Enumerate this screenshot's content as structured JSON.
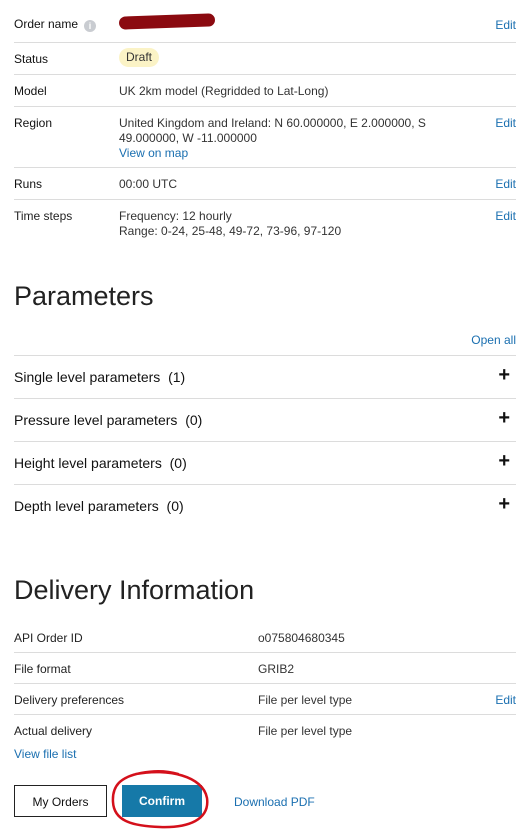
{
  "order": {
    "name_label": "Order name",
    "edit_label": "Edit",
    "status_label": "Status",
    "status_value": "Draft",
    "model_label": "Model",
    "model_value": "UK 2km model (Regridded to Lat-Long)",
    "region_label": "Region",
    "region_value_line1": "United Kingdom and Ireland: N 60.000000, E 2.000000, S",
    "region_value_line2": "49.000000, W -11.000000",
    "region_map_link": "View on map",
    "runs_label": "Runs",
    "runs_value": "00:00 UTC",
    "timesteps_label": "Time steps",
    "timesteps_frequency": "Frequency: 12 hourly",
    "timesteps_range": "Range: 0-24, 25-48, 49-72, 73-96, 97-120"
  },
  "parameters": {
    "heading": "Parameters",
    "open_all": "Open all",
    "groups": [
      {
        "label": "Single level parameters",
        "count": "(1)"
      },
      {
        "label": "Pressure level parameters",
        "count": "(0)"
      },
      {
        "label": "Height level parameters",
        "count": "(0)"
      },
      {
        "label": "Depth level parameters",
        "count": "(0)"
      }
    ],
    "expand_glyph": "+"
  },
  "delivery": {
    "heading": "Delivery Information",
    "api_label": "API Order ID",
    "api_value": "o075804680345",
    "format_label": "File format",
    "format_value": "GRIB2",
    "prefs_label": "Delivery preferences",
    "prefs_value": "File per level type",
    "prefs_edit": "Edit",
    "actual_label": "Actual delivery",
    "actual_value": "File per level type",
    "file_list_link": "View file list"
  },
  "actions": {
    "my_orders": "My Orders",
    "confirm": "Confirm",
    "download_pdf": "Download PDF"
  },
  "colors": {
    "link": "#1a6fb0",
    "primary": "#1679a8",
    "badge_bg": "#fbf3c6",
    "annotation": "#d4101b"
  }
}
